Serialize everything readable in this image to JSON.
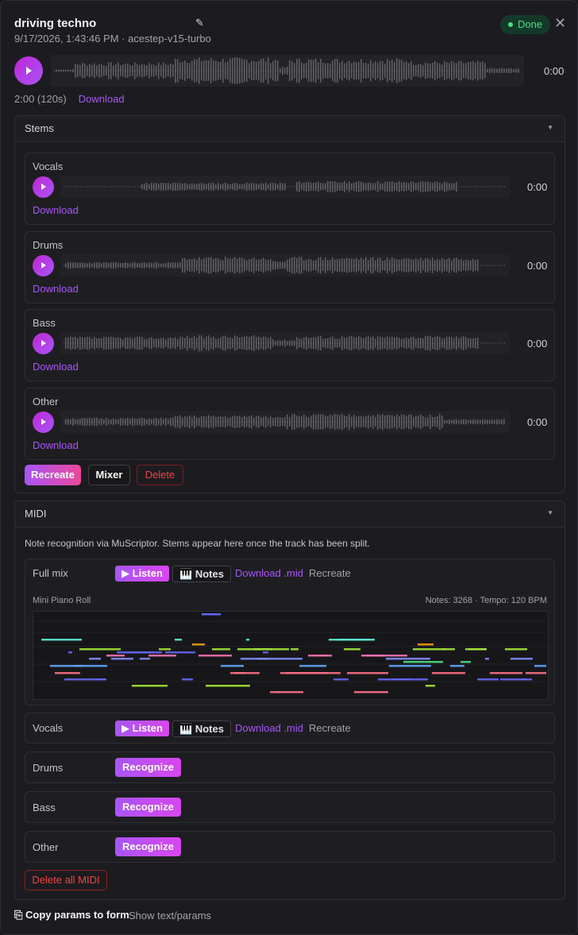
{
  "header": {
    "title": "driving techno",
    "subtitle": "9/17/2026, 1:43:46 PM · acestep-v15-turbo",
    "status": "Done",
    "edit_icon": "pencil-icon",
    "close_icon": "close-icon"
  },
  "player": {
    "time": "0:00",
    "duration": "2:00 (120s)",
    "download": "Download"
  },
  "stems": {
    "label": "Stems",
    "items": [
      {
        "name": "Vocals",
        "time": "0:00",
        "download": "Download"
      },
      {
        "name": "Drums",
        "time": "0:00",
        "download": "Download"
      },
      {
        "name": "Bass",
        "time": "0:00",
        "download": "Download"
      },
      {
        "name": "Other",
        "time": "0:00",
        "download": "Download"
      }
    ],
    "actions": {
      "recreate": "Recreate",
      "mixer": "Mixer",
      "delete": "Delete"
    }
  },
  "midi": {
    "label": "MIDI",
    "note": "Note recognition via MuScriptor. Stems appear here once the track has been split.",
    "full_mix": {
      "name": "Full mix",
      "listen": "Listen",
      "notes": "Notes",
      "download": "Download .mid",
      "recreate": "Recreate",
      "roll_label": "Mini Piano Roll",
      "roll_info": "Notes: 3268 · Tempo: 120 BPM"
    },
    "vocals": {
      "name": "Vocals",
      "listen": "Listen",
      "notes": "Notes",
      "download": "Download .mid",
      "recreate": "Recreate"
    },
    "drums": {
      "name": "Drums",
      "button": "Recognize"
    },
    "bass": {
      "name": "Bass",
      "button": "Recognize"
    },
    "other": {
      "name": "Other",
      "button": "Recognize"
    },
    "delete_all": "Delete all MIDI"
  },
  "footer": {
    "copy": "Copy params to form",
    "show": "Show text/params"
  },
  "colors": {
    "accent": "#a855f7",
    "accent2": "#ec4899",
    "done": "#4ade80",
    "danger": "#ef4444"
  }
}
